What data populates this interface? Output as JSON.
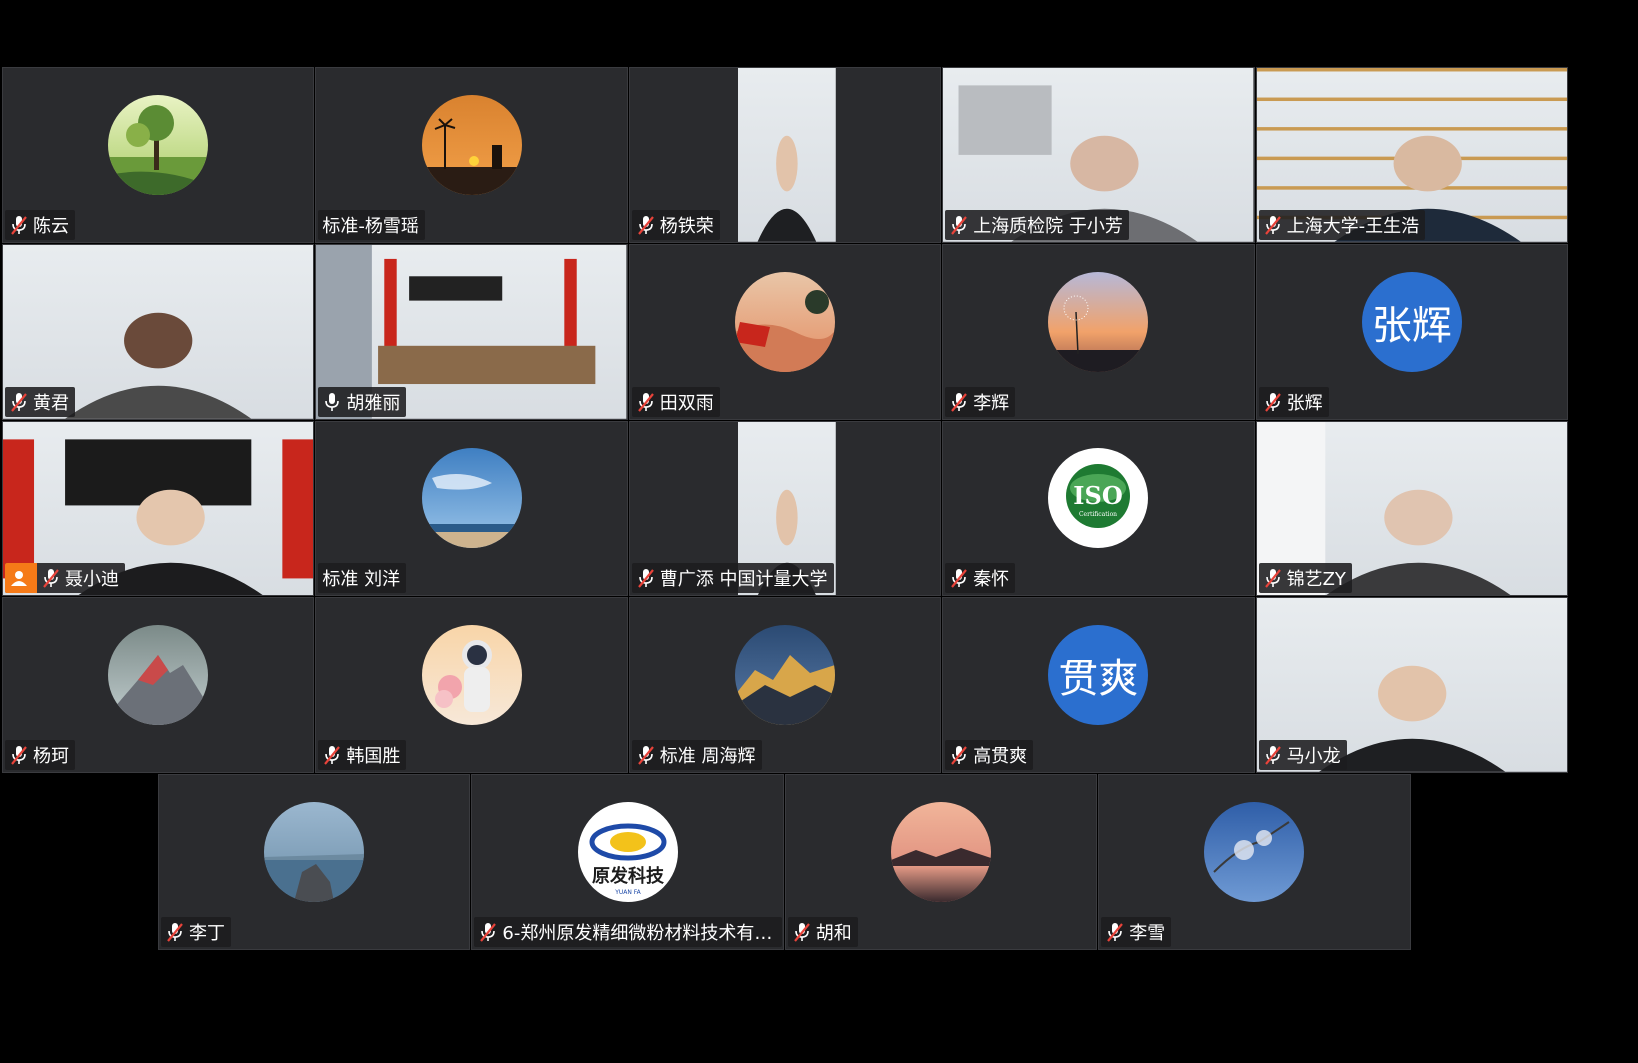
{
  "app": {
    "background": "#000000",
    "tile_color": "#2a2b2e"
  },
  "participants": [
    {
      "name": "陈云",
      "mic": "muted",
      "display": "avatar",
      "avatar_desc": "tree-landscape"
    },
    {
      "name": "标准-杨雪瑶",
      "mic": "none",
      "display": "avatar",
      "avatar_desc": "sunset-palm"
    },
    {
      "name": "杨铁荣",
      "mic": "muted",
      "display": "video",
      "video_desc": "man-in-jacket-outdoor"
    },
    {
      "name": "上海质检院 于小芳",
      "mic": "muted",
      "display": "video",
      "video_desc": "woman-lab"
    },
    {
      "name": "上海大学-王生浩",
      "mic": "muted",
      "display": "video",
      "video_desc": "man-bookshelf"
    },
    {
      "name": "黄君",
      "mic": "muted",
      "display": "video",
      "video_desc": "blurry-man"
    },
    {
      "name": "胡雅丽",
      "mic": "on",
      "display": "video",
      "video_desc": "meeting-room"
    },
    {
      "name": "田双雨",
      "mic": "muted",
      "display": "avatar",
      "avatar_desc": "sunset-flag"
    },
    {
      "name": "李辉",
      "mic": "muted",
      "display": "avatar",
      "avatar_desc": "dandelion-sunset"
    },
    {
      "name": "张辉",
      "mic": "muted",
      "display": "text-avatar",
      "avatar_text": "张辉",
      "avatar_color": "#2b6fcf"
    },
    {
      "name": "聂小迪",
      "mic": "muted",
      "display": "video",
      "video_desc": "man-office-flags",
      "host": true
    },
    {
      "name": "标准 刘洋",
      "mic": "none",
      "display": "avatar",
      "avatar_desc": "beach-sky"
    },
    {
      "name": "曹广添   中国计量大学",
      "mic": "muted",
      "display": "video",
      "video_desc": "man-glasses"
    },
    {
      "name": "秦怀",
      "mic": "muted",
      "display": "avatar",
      "avatar_desc": "iso-logo",
      "avatar_text": "ISO",
      "avatar_subtext": "Certification"
    },
    {
      "name": "锦艺ZY",
      "mic": "muted",
      "display": "video",
      "video_desc": "woman-white-room"
    },
    {
      "name": "杨珂",
      "mic": "muted",
      "display": "avatar",
      "avatar_desc": "mountain-peak"
    },
    {
      "name": "韩国胜",
      "mic": "muted",
      "display": "avatar",
      "avatar_desc": "astronaut-flowers"
    },
    {
      "name": "标准  周海辉",
      "mic": "muted",
      "display": "avatar",
      "avatar_desc": "snow-mountain"
    },
    {
      "name": "高贯爽",
      "mic": "muted",
      "display": "text-avatar",
      "avatar_text": "贯爽",
      "avatar_color": "#2b6fcf"
    },
    {
      "name": "马小龙",
      "mic": "muted",
      "display": "video",
      "video_desc": "man-glasses-white-room"
    },
    {
      "name": "李丁",
      "mic": "muted",
      "display": "avatar",
      "avatar_desc": "lake-rocks"
    },
    {
      "name": "6-郑州原发精细微粉材料技术有限...",
      "mic": "muted",
      "display": "avatar",
      "avatar_desc": "company-logo",
      "avatar_text": "原发科技",
      "avatar_subtext": "YUAN FA"
    },
    {
      "name": "胡和",
      "mic": "muted",
      "display": "avatar",
      "avatar_desc": "lake-sunset"
    },
    {
      "name": "李雪",
      "mic": "muted",
      "display": "avatar",
      "avatar_desc": "blossom-sky"
    }
  ]
}
